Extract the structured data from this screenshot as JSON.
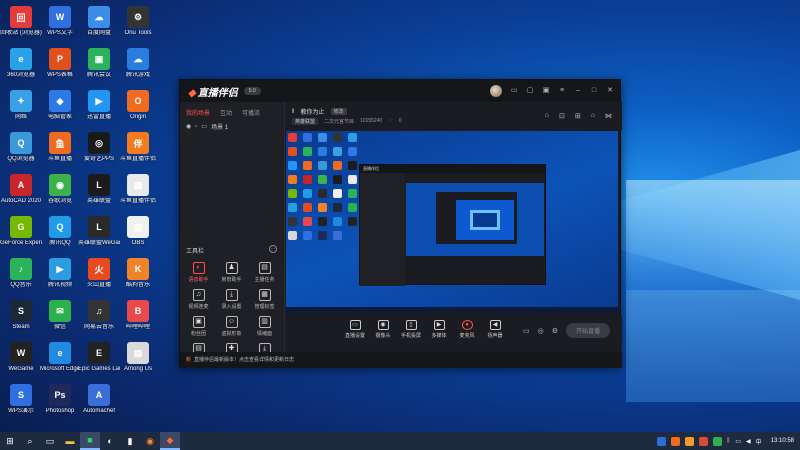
{
  "desktop": {
    "icons": [
      {
        "label": "回收站 (浏览器)",
        "color": "#e63b3b",
        "glyph": "回"
      },
      {
        "label": "WPS文字",
        "color": "#2f6fe0",
        "glyph": "W"
      },
      {
        "label": "百度网盘",
        "color": "#3a8ee8",
        "glyph": "☁"
      },
      {
        "label": "Onu Tools",
        "color": "#333333",
        "glyph": "⚙"
      },
      {
        "label": "360浏览器",
        "color": "#2aa1e6",
        "glyph": "e"
      },
      {
        "label": "WPS表格",
        "color": "#e0501f",
        "glyph": "P"
      },
      {
        "label": "腾讯会议",
        "color": "#2bb25a",
        "glyph": "▣"
      },
      {
        "label": "腾讯游戏",
        "color": "#2a7de0",
        "glyph": "☁"
      },
      {
        "label": "网络",
        "color": "#3aa0e6",
        "glyph": "✦"
      },
      {
        "label": "电脑管家",
        "color": "#2d7ae6",
        "glyph": "◆"
      },
      {
        "label": "迅雷直播",
        "color": "#2196f3",
        "glyph": "▶"
      },
      {
        "label": "Origin",
        "color": "#f06a1f",
        "glyph": "O"
      },
      {
        "label": "QQ浏览器",
        "color": "#3a9ad9",
        "glyph": "Q"
      },
      {
        "label": "斗鱼直播",
        "color": "#f06a1f",
        "glyph": "鱼"
      },
      {
        "label": "爱奇艺PPS",
        "color": "#1a1a1a",
        "glyph": "◎"
      },
      {
        "label": "斗鱼直播伴侣",
        "color": "#f27a1f",
        "glyph": "伴"
      },
      {
        "label": "AutoCAD 2020",
        "color": "#c8252c",
        "glyph": "A"
      },
      {
        "label": "谷歌浏览",
        "color": "#3bb34a",
        "glyph": "◉"
      },
      {
        "label": "英雄联盟",
        "color": "#1b1b1b",
        "glyph": "L"
      },
      {
        "label": "斗鱼直播伴侣",
        "color": "#e9e9e9",
        "glyph": "▤"
      },
      {
        "label": "GeForce Experience",
        "color": "#76b900",
        "glyph": "G"
      },
      {
        "label": "腾讯QQ",
        "color": "#1f9be8",
        "glyph": "Q"
      },
      {
        "label": "英雄联盟WeGame版",
        "color": "#2a2a2a",
        "glyph": "L"
      },
      {
        "label": "OBS",
        "color": "#f0f0f0",
        "glyph": "▤"
      },
      {
        "label": "QQ音乐",
        "color": "#2ab35a",
        "glyph": "♪"
      },
      {
        "label": "腾讯视频",
        "color": "#2a9de0",
        "glyph": "▶"
      },
      {
        "label": "火山直播",
        "color": "#e84a1f",
        "glyph": "火"
      },
      {
        "label": "酷狗音乐",
        "color": "#f0822a",
        "glyph": "K"
      },
      {
        "label": "Steam",
        "color": "#1b2838",
        "glyph": "S"
      },
      {
        "label": "微信",
        "color": "#2bb24c",
        "glyph": "✉"
      },
      {
        "label": "网易云音乐",
        "color": "#333333",
        "glyph": "♫"
      },
      {
        "label": "哔哩哔哩",
        "color": "#e84a4a",
        "glyph": "B"
      },
      {
        "label": "WeGame",
        "color": "#222222",
        "glyph": "W"
      },
      {
        "label": "Microsoft Edge",
        "color": "#1f8ae0",
        "glyph": "e"
      },
      {
        "label": "Epic Games Launcher",
        "color": "#222222",
        "glyph": "E"
      },
      {
        "label": "Among Us",
        "color": "#d9d9d9",
        "glyph": "▤"
      },
      {
        "label": "WPS演示",
        "color": "#2f6fe0",
        "glyph": "S"
      },
      {
        "label": "Photoshop",
        "color": "#1e2a5a",
        "glyph": "Ps"
      },
      {
        "label": "Automachef",
        "color": "#3a6fd8",
        "glyph": "A"
      }
    ]
  },
  "app": {
    "logo": "直播伴侣",
    "version": "5.0",
    "tabs": [
      "我的场景",
      "互动",
      "可播流"
    ],
    "scene_name": "场景 1",
    "tools_title": "工具栏",
    "tools": [
      {
        "label": "语音助手",
        "glyph": "◐",
        "hot": true
      },
      {
        "label": "房管助手",
        "glyph": "♟",
        "hot": false
      },
      {
        "label": "主播任务",
        "glyph": "▤",
        "hot": false
      },
      {
        "label": "视频连麦",
        "glyph": "♫",
        "hot": false
      },
      {
        "label": "录入设置",
        "glyph": "⤓",
        "hot": false
      },
      {
        "label": "管理标签",
        "glyph": "▦",
        "hot": false
      },
      {
        "label": "粉丝团",
        "glyph": "▣",
        "hot": false
      },
      {
        "label": "虚拟形象",
        "glyph": "☺",
        "hot": false
      },
      {
        "label": "情绪面",
        "glyph": "▥",
        "hot": false
      },
      {
        "label": "弹幕",
        "glyph": "▤",
        "hot": false
      },
      {
        "label": "更多",
        "glyph": "✚",
        "hot": false
      },
      {
        "label": "录制",
        "glyph": "⤓",
        "hot": false
      }
    ],
    "topbar": {
      "title": "教你为止",
      "tag": "修改",
      "category": "英雄联盟",
      "room_label": "二次元官节目",
      "room_id": "10155240",
      "likes": "0"
    },
    "bottom": [
      {
        "label": "直播设置",
        "glyph": "▭"
      },
      {
        "label": "摄像头",
        "glyph": "◉"
      },
      {
        "label": "手机投屏",
        "glyph": "▯"
      },
      {
        "label": "多媒体",
        "glyph": "▶"
      },
      {
        "label": "麦克风",
        "glyph": "●",
        "mic": true
      },
      {
        "label": "扬声器",
        "glyph": "◀"
      }
    ],
    "golive": "开始直播",
    "notice_badge": "新",
    "notice": "直播伴侣最新版本！点击查看详情和更新日志"
  },
  "taskbar": {
    "clock": "13:10:58"
  }
}
